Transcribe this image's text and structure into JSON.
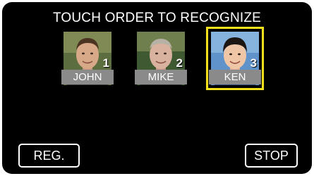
{
  "title": "TOUCH ORDER TO RECOGNIZE",
  "faces": [
    {
      "name": "JOHN",
      "order": "1",
      "selected": false
    },
    {
      "name": "MIKE",
      "order": "2",
      "selected": false
    },
    {
      "name": "KEN",
      "order": "3",
      "selected": true
    }
  ],
  "buttons": {
    "reg_label": "REG.",
    "stop_label": "STOP"
  },
  "colors": {
    "background": "#000000",
    "selection_frame": "#f2e11c",
    "name_bar": "#8a8a8a",
    "text": "#ffffff"
  }
}
